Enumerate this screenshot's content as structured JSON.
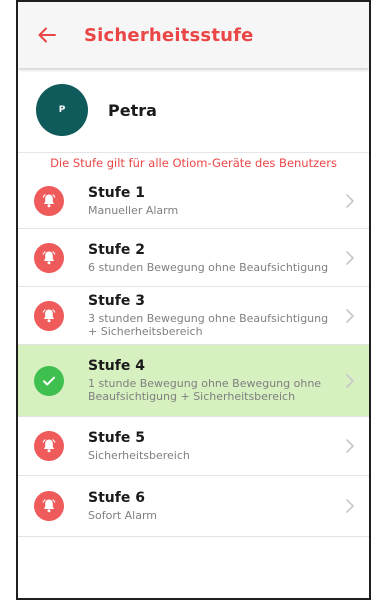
{
  "header": {
    "title": "Sicherheitsstufe",
    "back_icon": "arrow-left-icon"
  },
  "user": {
    "initial": "P",
    "name": "Petra"
  },
  "info_text": "Die Stufe gilt für alle Otiom-Geräte des Benutzers",
  "colors": {
    "accent": "#ea4646",
    "selected_bg": "#d6f0c0",
    "check": "#3fbf4e",
    "avatar": "#0f5b5b"
  },
  "levels": [
    {
      "title": "Stufe 1",
      "subtitle": "Manueller Alarm",
      "icon": "bell-icon",
      "selected": false
    },
    {
      "title": "Stufe 2",
      "subtitle": "6 stunden Bewegung ohne Beaufsichtigung",
      "icon": "bell-icon",
      "selected": false
    },
    {
      "title": "Stufe 3",
      "subtitle": "3 stunden Bewegung ohne Beaufsichtigung + Sicherheitsbereich",
      "icon": "bell-icon",
      "selected": false
    },
    {
      "title": "Stufe 4",
      "subtitle": "1 stunde Bewegung ohne Bewegung ohne Beaufsichtigung + Sicherheitsbereich",
      "icon": "check-icon",
      "selected": true
    },
    {
      "title": "Stufe 5",
      "subtitle": "Sicherheitsbereich",
      "icon": "bell-icon",
      "selected": false
    },
    {
      "title": "Stufe 6",
      "subtitle": "Sofort Alarm",
      "icon": "bell-icon",
      "selected": false
    }
  ]
}
